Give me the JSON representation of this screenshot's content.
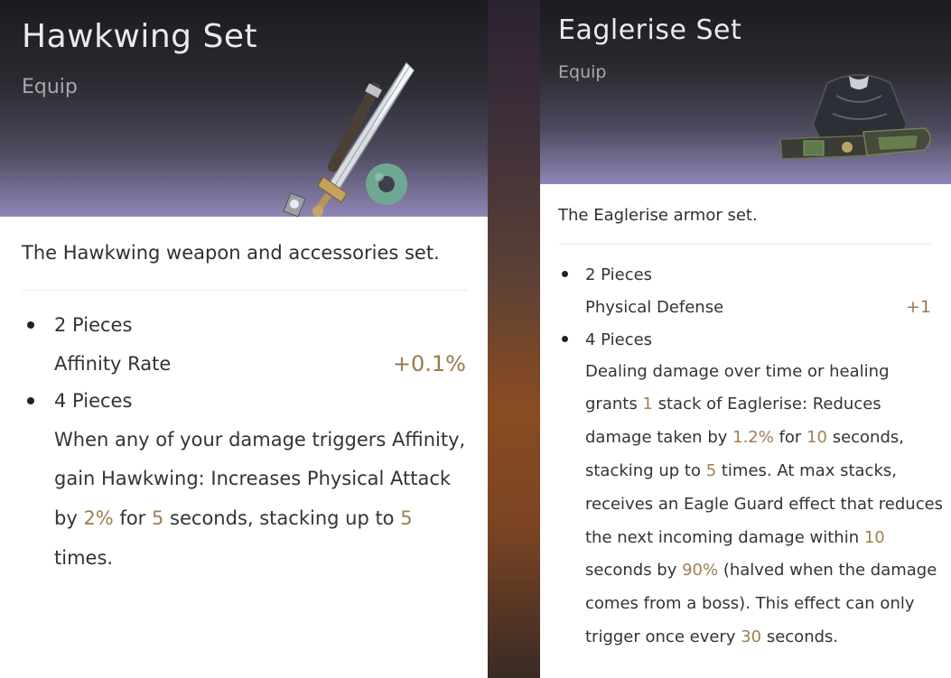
{
  "left_card": {
    "title": "Hawkwing Set",
    "subtitle": "Equip",
    "description": "The Hawkwing weapon and accessories set.",
    "tier1": {
      "label": "2 Pieces",
      "stat": "Affinity Rate",
      "value": "+0.1%"
    },
    "tier2": {
      "label": "4 Pieces",
      "line1": "When any of your damage triggers Affinity,",
      "line2": "gain Hawkwing: Increases Physical Attack",
      "l3_a": "by ",
      "l3_b": "2%",
      "l3_c": " for ",
      "l3_d": "5",
      "l3_e": " seconds, stacking up to ",
      "l3_f": "5",
      "line4": "times."
    },
    "art_icons": [
      "sword-icon",
      "jade-ring-icon"
    ]
  },
  "right_card": {
    "title": "Eaglerise Set",
    "subtitle": "Equip",
    "description": "The Eaglerise armor set.",
    "tier1": {
      "label": "2 Pieces",
      "stat": "Physical Defense",
      "value": "+1"
    },
    "tier2": {
      "label": "4 Pieces",
      "line1": "Dealing damage over time or healing",
      "l2_a": "grants ",
      "l2_b": "1",
      "l2_c": " stack of Eaglerise: Reduces",
      "l3_a": "damage taken by ",
      "l3_b": "1.2%",
      "l3_c": " for ",
      "l3_d": "10",
      "l3_e": " seconds,",
      "l4_a": "stacking up to ",
      "l4_b": "5",
      "l4_c": " times. At max stacks,",
      "line5": "receives an Eagle Guard effect that reduces",
      "l6_a": "the next incoming damage within ",
      "l6_b": "10",
      "l7_a": "seconds by ",
      "l7_b": "90%",
      "l7_c": " (halved when the damage",
      "line8": "comes from a boss). This effect can only",
      "l9_a": "trigger once every ",
      "l9_b": "30",
      "l9_c": " seconds."
    },
    "art_icons": [
      "armor-icon",
      "belt-icon"
    ]
  },
  "colors": {
    "highlight": "#a17f52",
    "header_top": "#1b1b1f",
    "header_bottom": "#8f87b6"
  }
}
